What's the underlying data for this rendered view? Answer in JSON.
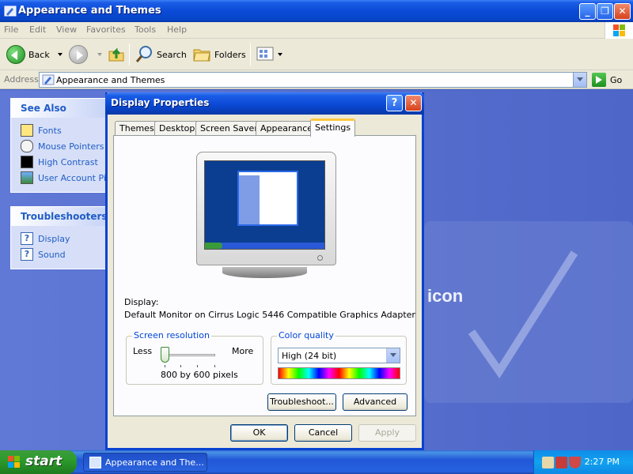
{
  "window": {
    "title": "Appearance and Themes",
    "minimize": "_",
    "maximize": "❐",
    "close": "✕"
  },
  "menu": [
    "File",
    "Edit",
    "View",
    "Favorites",
    "Tools",
    "Help"
  ],
  "toolbar": {
    "back": "Back",
    "search": "Search",
    "folders": "Folders"
  },
  "address": {
    "label": "Address",
    "value": "Appearance and Themes",
    "go": "Go"
  },
  "sidebar": {
    "see_also": {
      "title": "See Also",
      "items": [
        "Fonts",
        "Mouse Pointers",
        "High Contrast",
        "User Account Pict"
      ]
    },
    "troubleshooters": {
      "title": "Troubleshooters",
      "items": [
        "Display",
        "Sound"
      ]
    }
  },
  "background": {
    "partial_text": "icon"
  },
  "dialog": {
    "title": "Display Properties",
    "help": "?",
    "close": "✕",
    "tabs": [
      "Themes",
      "Desktop",
      "Screen Saver",
      "Appearance",
      "Settings"
    ],
    "active_tab": "Settings",
    "display_label": "Display:",
    "display_value": "Default Monitor on Cirrus Logic 5446 Compatible Graphics Adapter",
    "resolution": {
      "title": "Screen resolution",
      "less": "Less",
      "more": "More",
      "value": "800 by 600 pixels"
    },
    "color": {
      "title": "Color quality",
      "value": "High (24 bit)"
    },
    "buttons": {
      "troubleshoot": "Troubleshoot...",
      "advanced": "Advanced",
      "ok": "OK",
      "cancel": "Cancel",
      "apply": "Apply"
    }
  },
  "taskbar": {
    "start": "start",
    "task": "Appearance and The...",
    "clock": "2:27 PM"
  },
  "colors": {
    "title_bar": "#0a4ad6",
    "link": "#215dc6",
    "desktop": "#3b5fc9",
    "start_green": "#2d9b2d"
  }
}
